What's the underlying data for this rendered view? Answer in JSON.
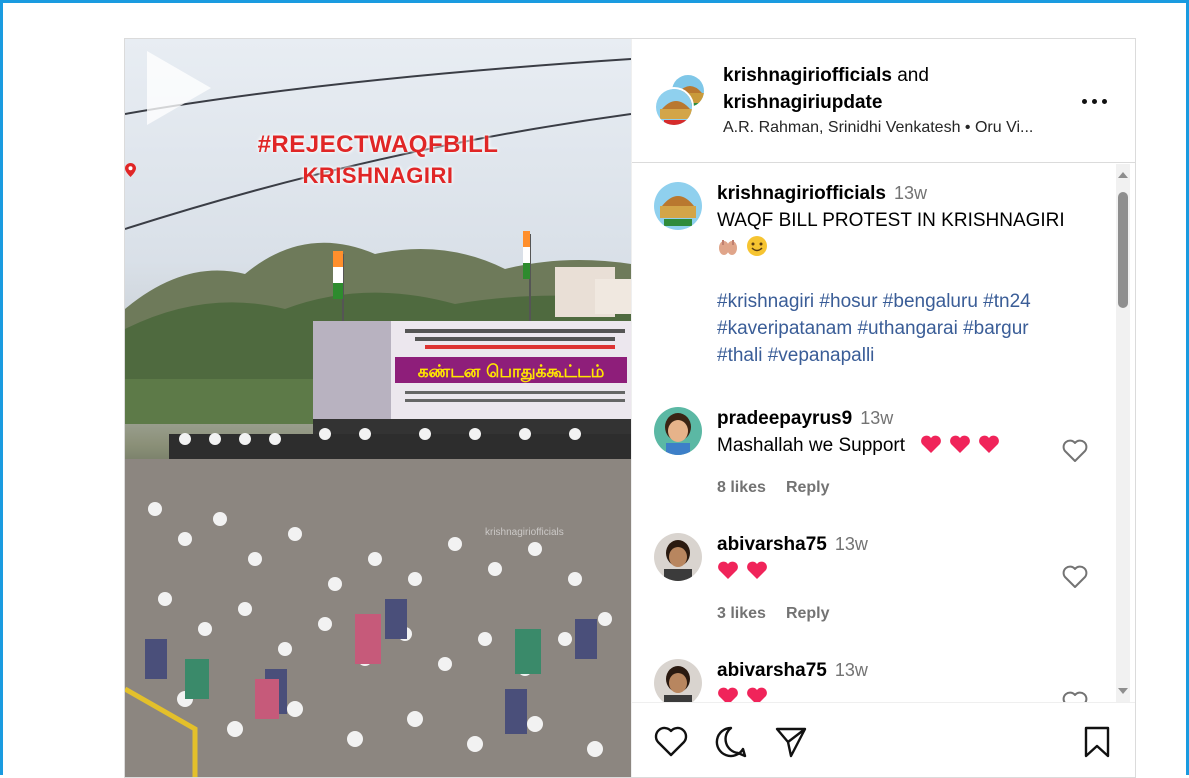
{
  "video": {
    "overlay_line1": "#REJECTWAQFBILL",
    "overlay_line2": "KRISHNAGIRI",
    "banner_text": "கண்டன பொதுக்கூட்டம்",
    "watermark": "krishnagiriofficials",
    "play_icon": "play-icon"
  },
  "header": {
    "user1": "krishnagiriofficials",
    "joiner": " and",
    "user2": "krishnagiriupdate",
    "audio": "A.R. Rahman, Srinidhi Venkatesh • Oru Vi..."
  },
  "caption": {
    "username": "krishnagiriofficials",
    "time": "13w",
    "text": "WAQF BILL PROTEST IN KRISHNAGIRI",
    "emojis": [
      "raised-hands-emoji",
      "smiling-face-emoji"
    ],
    "hashtags_line1": "#krishnagiri #hosur #bengaluru #tn24",
    "hashtags_line2": "#kaveripatanam #uthangarai #bargur",
    "hashtags_line3": "#thali #vepanapalli"
  },
  "comments": [
    {
      "username": "pradeepayrus9",
      "time": "13w",
      "text": "Mashallah we Support",
      "hearts": 3,
      "likes": "8 likes",
      "reply": "Reply"
    },
    {
      "username": "abivarsha75",
      "time": "13w",
      "text": "",
      "hearts": 2,
      "likes": "3 likes",
      "reply": "Reply"
    },
    {
      "username": "abivarsha75",
      "time": "13w",
      "text": "",
      "hearts": 2,
      "likes": "",
      "reply": ""
    }
  ],
  "colors": {
    "frame_border": "#1a9be0",
    "hashtag": "#3a5d97",
    "muted": "#737373",
    "overlay_red": "#e02626",
    "heart_emoji": "#f0245a"
  }
}
